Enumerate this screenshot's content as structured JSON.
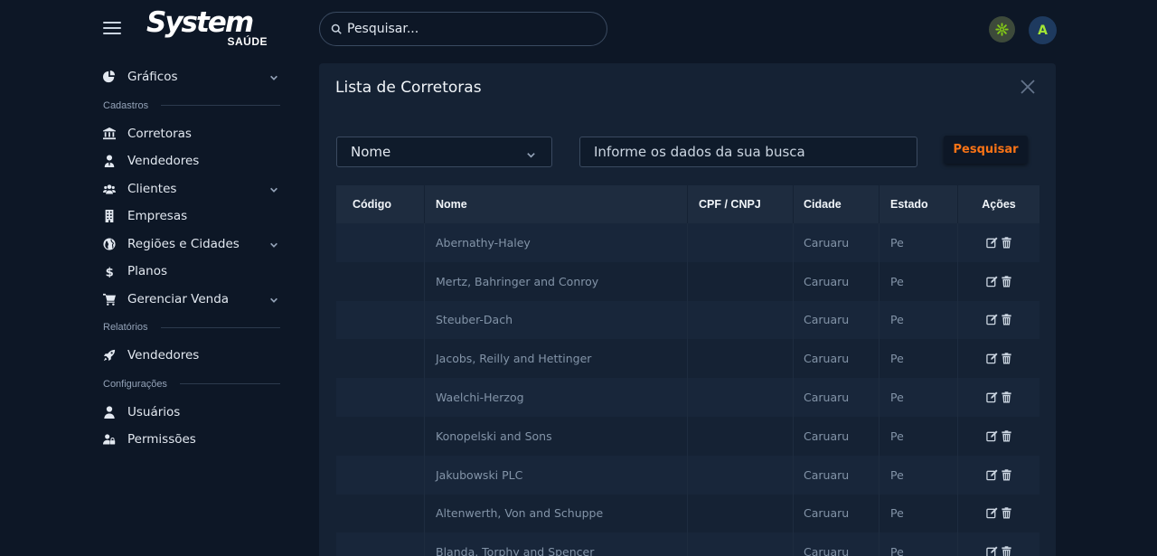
{
  "brand": {
    "name": "System",
    "sub": "SAÚDE"
  },
  "search": {
    "placeholder": "Pesquisar..."
  },
  "user": {
    "initial": "A"
  },
  "sidebar": {
    "items": [
      {
        "label": "Gráficos",
        "icon": "chart-pie-icon",
        "chevron": true
      },
      {
        "section": "Cadastros"
      },
      {
        "label": "Corretoras",
        "icon": "bank-icon",
        "chevron": false
      },
      {
        "label": "Vendedores",
        "icon": "user-tie-icon",
        "chevron": false
      },
      {
        "label": "Clientes",
        "icon": "users-icon",
        "chevron": true
      },
      {
        "label": "Empresas",
        "icon": "building-icon",
        "chevron": false
      },
      {
        "label": "Regiões e Cidades",
        "icon": "globe-icon",
        "chevron": true
      },
      {
        "label": "Planos",
        "icon": "dollar-icon",
        "chevron": false
      },
      {
        "label": "Gerenciar Venda",
        "icon": "cart-icon",
        "chevron": true
      },
      {
        "section": "Relatórios"
      },
      {
        "label": "Vendedores",
        "icon": "rocket-icon",
        "chevron": false
      },
      {
        "section": "Configurações"
      },
      {
        "label": "Usuários",
        "icon": "user-icon",
        "chevron": false
      },
      {
        "label": "Permissões",
        "icon": "user-lock-icon",
        "chevron": false
      }
    ]
  },
  "main": {
    "title": "Lista de Corretoras",
    "filter": {
      "select_value": "Nome",
      "input_placeholder": "Informe os dados da sua busca",
      "button_label": "Pesquisar"
    },
    "table": {
      "headers": [
        "Código",
        "Nome",
        "CPF / CNPJ",
        "Cidade",
        "Estado",
        "Ações"
      ],
      "rows": [
        {
          "codigo": "",
          "nome": "Abernathy-Haley",
          "cpf": "",
          "cidade": "Caruaru",
          "estado": "Pe"
        },
        {
          "codigo": "",
          "nome": "Mertz, Bahringer and Conroy",
          "cpf": "",
          "cidade": "Caruaru",
          "estado": "Pe"
        },
        {
          "codigo": "",
          "nome": "Steuber-Dach",
          "cpf": "",
          "cidade": "Caruaru",
          "estado": "Pe"
        },
        {
          "codigo": "",
          "nome": "Jacobs, Reilly and Hettinger",
          "cpf": "",
          "cidade": "Caruaru",
          "estado": "Pe"
        },
        {
          "codigo": "",
          "nome": "Waelchi-Herzog",
          "cpf": "",
          "cidade": "Caruaru",
          "estado": "Pe"
        },
        {
          "codigo": "",
          "nome": "Konopelski and Sons",
          "cpf": "",
          "cidade": "Caruaru",
          "estado": "Pe"
        },
        {
          "codigo": "",
          "nome": "Jakubowski PLC",
          "cpf": "",
          "cidade": "Caruaru",
          "estado": "Pe"
        },
        {
          "codigo": "",
          "nome": "Altenwerth, Von and Schuppe",
          "cpf": "",
          "cidade": "Caruaru",
          "estado": "Pe"
        },
        {
          "codigo": "",
          "nome": "Blanda, Torphy and Spencer",
          "cpf": "",
          "cidade": "Caruaru",
          "estado": "Pe"
        }
      ]
    }
  },
  "colors": {
    "background": "#0d1726",
    "card": "#152234",
    "accent_orange": "#f97316",
    "gear_icon": "#84cc16",
    "avatar_text": "#a3e635"
  }
}
